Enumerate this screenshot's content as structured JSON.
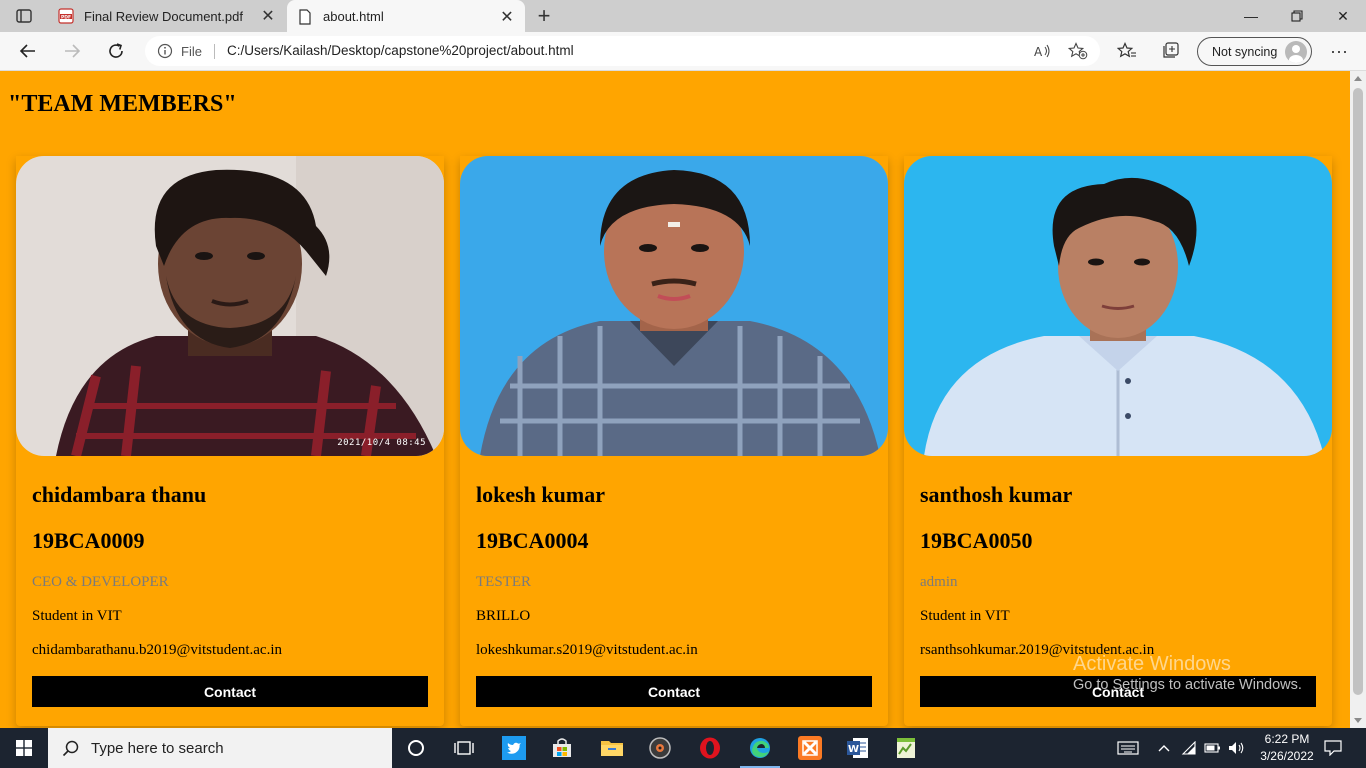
{
  "browser": {
    "tabs": [
      {
        "title": "Final Review Document.pdf",
        "icon": "pdf-icon",
        "active": false
      },
      {
        "title": "about.html",
        "icon": "page-icon",
        "active": true
      }
    ],
    "address": {
      "scheme_label": "File",
      "url": "C:/Users/Kailash/Desktop/capstone%20project/about.html"
    },
    "profile": {
      "label": "Not syncing"
    }
  },
  "page": {
    "title": "\"TEAM MEMBERS\"",
    "background": "#ffa500",
    "members": [
      {
        "name": "chidambara thanu",
        "reg_no": "19BCA0009",
        "role": "CEO & DEVELOPER",
        "org": "Student in VIT",
        "email": "chidambarathanu.b2019@vitstudent.ac.in",
        "photo_stamp": "2021/10/4 08:45",
        "contact_label": "Contact"
      },
      {
        "name": "lokesh kumar",
        "reg_no": "19BCA0004",
        "role": "TESTER",
        "org": "BRILLO",
        "email": "lokeshkumar.s2019@vitstudent.ac.in",
        "contact_label": "Contact"
      },
      {
        "name": "santhosh kumar",
        "reg_no": "19BCA0050",
        "role": "admin",
        "org": "Student in VIT",
        "email": "rsanthsohkumar.2019@vitstudent.ac.in",
        "contact_label": "Contact"
      }
    ]
  },
  "watermark": {
    "line1": "Activate Windows",
    "line2": "Go to Settings to activate Windows."
  },
  "taskbar": {
    "search_placeholder": "Type here to search",
    "time": "6:22 PM",
    "date": "3/26/2022"
  }
}
